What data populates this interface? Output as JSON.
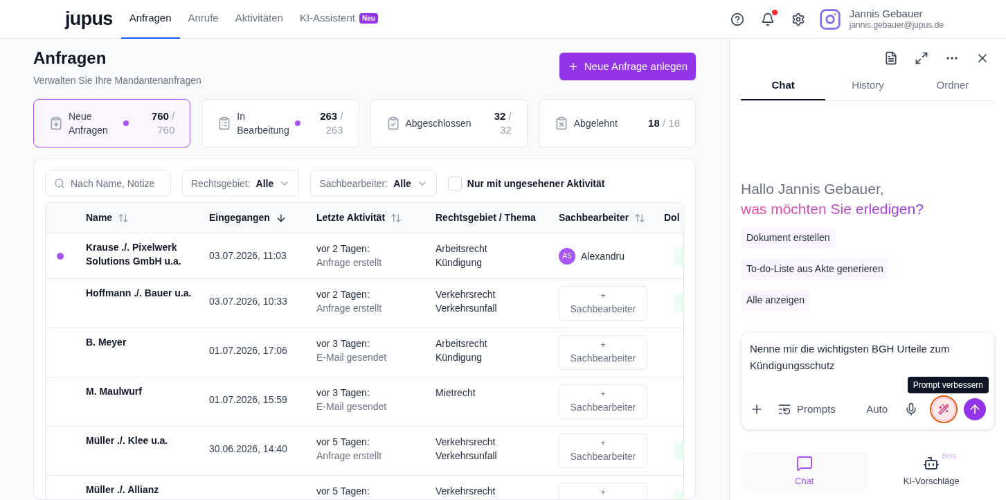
{
  "nav": {
    "logo": "jupus",
    "tabs": [
      {
        "label": "Anfragen",
        "selected": true
      },
      {
        "label": "Anrufe",
        "selected": false
      },
      {
        "label": "Aktivitäten",
        "selected": false
      },
      {
        "label": "KI-Assistent",
        "selected": false,
        "badge": "Neu"
      }
    ]
  },
  "user": {
    "name": "Jannis Gebauer",
    "email": "jannis.gebauer@jupus.de",
    "notifications_unread": true
  },
  "page": {
    "title": "Anfragen",
    "subtitle": "Verwalten Sie Ihre Mandantenanfragen",
    "new_button": "Neue Anfrage anlegen"
  },
  "stats": [
    {
      "kind": "new",
      "label": "Neue Anfragen",
      "count": "760",
      "total": "/ 760",
      "selected": true,
      "unread": true
    },
    {
      "kind": "progress",
      "label": "In Bearbeitung",
      "count": "263",
      "total": "/ 263",
      "selected": false,
      "unread": true
    },
    {
      "kind": "done",
      "label": "Abgeschlossen",
      "count": "32",
      "total": "/ 32",
      "selected": false,
      "unread": false
    },
    {
      "kind": "rejected",
      "label": "Abgelehnt",
      "count": "18",
      "total": "/ 18",
      "selected": false,
      "unread": false
    }
  ],
  "filters": {
    "search_placeholder": "Nach Name, Notize",
    "rechtsgebiet": {
      "label": "Rechtsgebiet:",
      "value": "Alle"
    },
    "sachbearbeiter": {
      "label": "Sachbearbeiter:",
      "value": "Alle"
    },
    "unseen_only": {
      "label": "Nur mit ungesehener Aktivität",
      "checked": false
    }
  },
  "table": {
    "columns": [
      {
        "label": "Name",
        "kind": "sortable"
      },
      {
        "label": "Eingegangen",
        "kind": "sorted"
      },
      {
        "label": "Letzte Aktivität",
        "kind": "sortable"
      },
      {
        "label": "Rechtsgebiet / Thema",
        "kind": "plain"
      },
      {
        "label": "Sachbearbeiter",
        "kind": "sortable"
      },
      {
        "label": "Dol",
        "kind": "plain"
      }
    ],
    "rows": [
      {
        "unread": true,
        "name": "Krause ./. Pixelwerk Solutions GmbH u.a.",
        "received": "03.07.2026, 11:03",
        "activity_time": "vor 2 Tagen:",
        "activity_text": "Anfrage erstellt",
        "area": "Arbeitsrecht",
        "topic": "Kündigung",
        "assignee": {
          "initials": "AS",
          "name": "Alexandru"
        },
        "badge": true
      },
      {
        "unread": false,
        "name": "Hoffmann ./. Bauer u.a.",
        "received": "03.07.2026, 10:33",
        "activity_time": "vor 2 Tagen:",
        "activity_text": "Anfrage erstellt",
        "area": "Verkehrsrecht",
        "topic": "Verkehrsunfall",
        "assign": {
          "icon": "+",
          "label": "Sachbearbeiter"
        },
        "badge": true
      },
      {
        "unread": false,
        "name": "B. Meyer",
        "received": "01.07.2026, 17:06",
        "activity_time": "vor 3 Tagen:",
        "activity_text": "E-Mail gesendet",
        "area": "Arbeitsrecht",
        "topic": "Kündigung",
        "assign": {
          "icon": "+",
          "label": "Sachbearbeiter"
        },
        "badge": false
      },
      {
        "unread": false,
        "name": "M. Maulwurf",
        "received": "01.07.2026, 15:59",
        "activity_time": "vor 3 Tagen:",
        "activity_text": "E-Mail gesendet",
        "area": "Mietrecht",
        "assign": {
          "icon": "+",
          "label": "Sachbearbeiter"
        },
        "badge": false
      },
      {
        "unread": false,
        "name": "Müller ./. Klee u.a.",
        "received": "30.06.2026, 14:40",
        "activity_time": "vor 5 Tagen:",
        "activity_text": "Anfrage erstellt",
        "area": "Verkehrsrecht",
        "topic": "Verkehrsunfall",
        "assign": {
          "icon": "+",
          "label": "Sachbearbeiter"
        },
        "badge": true
      },
      {
        "unread": false,
        "name": "Müller ./. Allianz",
        "activity_time": "vor 5 Tagen:",
        "area": "Verkehrsrecht",
        "assign": {
          "icon": "+"
        },
        "badge": true
      }
    ]
  },
  "chat": {
    "tabs": [
      {
        "label": "Chat",
        "selected": true
      },
      {
        "label": "History",
        "selected": false
      },
      {
        "label": "Ordner",
        "selected": false
      }
    ],
    "greeting": "Hallo Jannis Gebauer,",
    "question": "was möchten Sie erledigen?",
    "suggestions": [
      "Dokument erstellen",
      "To-do-Liste aus Akte generieren",
      "Alle anzeigen"
    ],
    "input_value": "Nenne mir die wichtigsten BGH Urteile zum Kündigungsschutz",
    "tooltip": "Prompt verbessern",
    "prompts_button": "Prompts",
    "model": "Auto",
    "bottom_tabs": [
      {
        "kind": "chat",
        "label": "Chat",
        "selected": true
      },
      {
        "kind": "bot",
        "label": "KI-Vorschläge",
        "selected": false,
        "badge": "Beta"
      }
    ]
  }
}
